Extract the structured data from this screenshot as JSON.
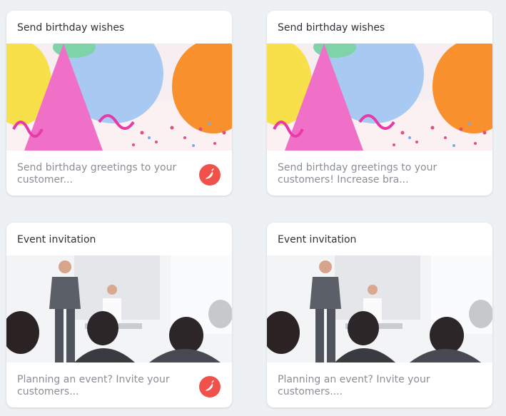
{
  "cards": [
    {
      "title": "Send birthday wishes",
      "description": "Send birthday greetings to your customer...",
      "badge_icon": "chili-pepper-icon"
    },
    {
      "title": "Send birthday wishes",
      "description": "Send birthday greetings to your customers! Increase bra..."
    },
    {
      "title": "Event invitation",
      "description": "Planning an event? Invite your customers...",
      "badge_icon": "chili-pepper-icon"
    },
    {
      "title": "Event invitation",
      "description": "Planning an event? Invite your customers...."
    }
  ],
  "colors": {
    "background": "#eef1f4",
    "card": "#ffffff",
    "badge": "#f0524b",
    "title": "#2f3237",
    "description": "#8a8f96"
  }
}
